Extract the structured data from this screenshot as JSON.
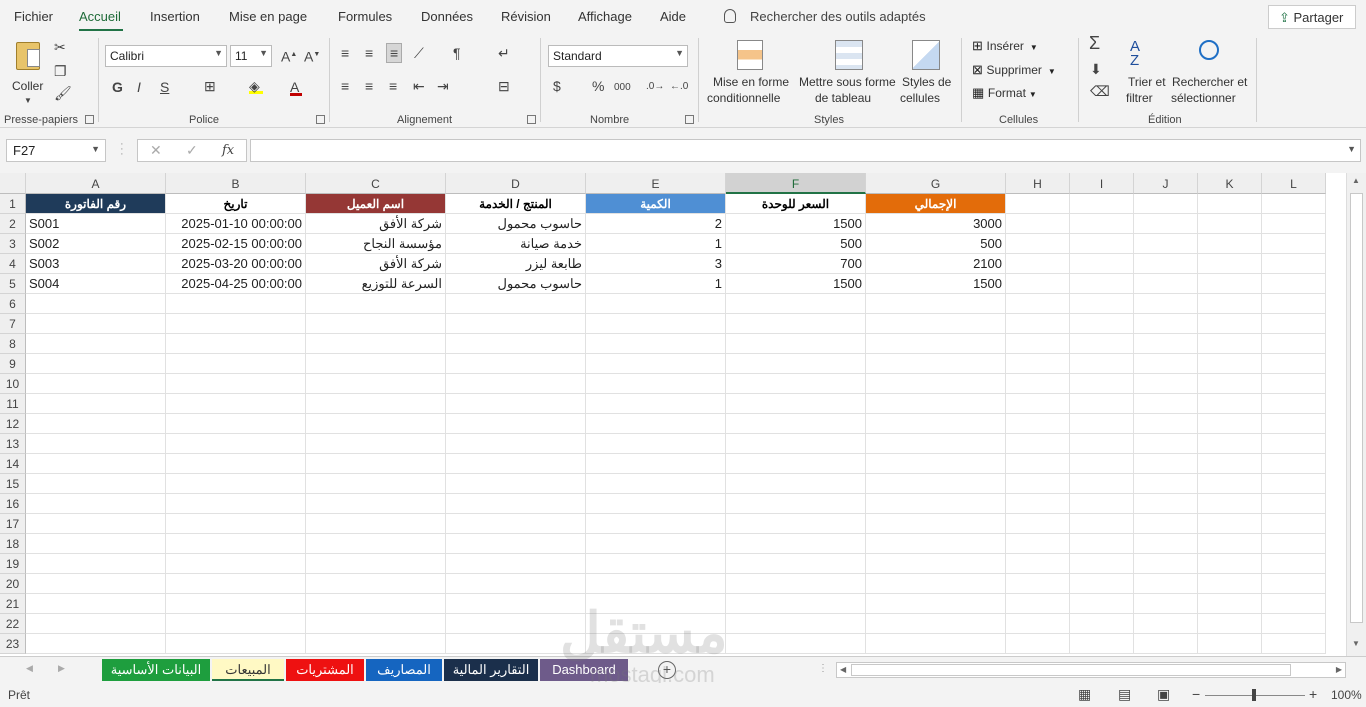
{
  "menu": {
    "tabs": [
      "Fichier",
      "Accueil",
      "Insertion",
      "Mise en page",
      "Formules",
      "Données",
      "Révision",
      "Affichage",
      "Aide"
    ],
    "active": "Accueil",
    "tell_me": "Rechercher des outils adaptés",
    "share": "Partager"
  },
  "ribbon": {
    "clipboard": {
      "paste_label": "Coller",
      "group": "Presse-papiers"
    },
    "font": {
      "name": "Calibri",
      "size": "11",
      "bold": "G",
      "italic": "I",
      "underline": "S",
      "group": "Police"
    },
    "alignment": {
      "group": "Alignement"
    },
    "number": {
      "format": "Standard",
      "percent": "%",
      "thousands": "000",
      "group": "Nombre"
    },
    "styles": {
      "conditional": [
        "Mise en forme",
        "conditionnelle"
      ],
      "table": [
        "Mettre sous forme",
        "de tableau"
      ],
      "cell_styles": [
        "Styles de",
        "cellules"
      ],
      "group": "Styles"
    },
    "cells": {
      "insert": "Insérer",
      "delete": "Supprimer",
      "format": "Format",
      "group": "Cellules"
    },
    "editing": {
      "sort": [
        "Trier et",
        "filtrer"
      ],
      "find": [
        "Rechercher et",
        "sélectionner"
      ],
      "group": "Édition"
    }
  },
  "formula_bar": {
    "name_box": "F27",
    "fx": "fx",
    "value": ""
  },
  "columns": [
    "A",
    "B",
    "C",
    "D",
    "E",
    "F",
    "G",
    "H",
    "I",
    "J",
    "K",
    "L"
  ],
  "selected_column": "F",
  "rows": [
    "1",
    "2",
    "3",
    "4",
    "5",
    "6",
    "7",
    "8",
    "9",
    "10",
    "11",
    "12",
    "13",
    "14",
    "15",
    "16",
    "17",
    "18",
    "19",
    "20",
    "21",
    "22",
    "23"
  ],
  "header_row": [
    "رقم الفاتورة",
    "تاريخ",
    "اسم العميل",
    "المنتج / الخدمة",
    "الكمية",
    "السعر للوحدة",
    "الإجمالي"
  ],
  "header_colors": {
    "A": "#1f3b5a",
    "B": "#ffffff",
    "C": "#953735",
    "D": "#ffffff",
    "E": "#4f8fd4",
    "F": "#ffffff",
    "G": "#e36c0a"
  },
  "data_rows": [
    [
      "S001",
      "2025-01-10 00:00:00",
      "شركة الأفق",
      "حاسوب محمول",
      "2",
      "1500",
      "3000"
    ],
    [
      "S002",
      "2025-02-15 00:00:00",
      "مؤسسة النجاح",
      "خدمة صيانة",
      "1",
      "500",
      "500"
    ],
    [
      "S003",
      "2025-03-20 00:00:00",
      "شركة الأفق",
      "طابعة ليزر",
      "3",
      "700",
      "2100"
    ],
    [
      "S004",
      "2025-04-25 00:00:00",
      "السرعة للتوزيع",
      "حاسوب محمول",
      "1",
      "1500",
      "1500"
    ]
  ],
  "sheet_tabs": [
    {
      "label": "البيانات الأساسية",
      "bg": "#1e9e3e",
      "fg": "#ffffff"
    },
    {
      "label": "المبيعات",
      "bg": "#fff9c4",
      "fg": "#333333"
    },
    {
      "label": "المشتريات",
      "bg": "#ee1111",
      "fg": "#ffffff"
    },
    {
      "label": "المصاريف",
      "bg": "#1565c0",
      "fg": "#ffffff"
    },
    {
      "label": "التقارير المالية",
      "bg": "#1b2f4b",
      "fg": "#ffffff"
    },
    {
      "label": "Dashboard",
      "bg": "#6e5b8a",
      "fg": "#ffffff"
    }
  ],
  "status": {
    "text": "Prêt",
    "zoom": "100%"
  },
  "watermark": {
    "arabic": "مستقل",
    "latin": "mostaql.com"
  }
}
